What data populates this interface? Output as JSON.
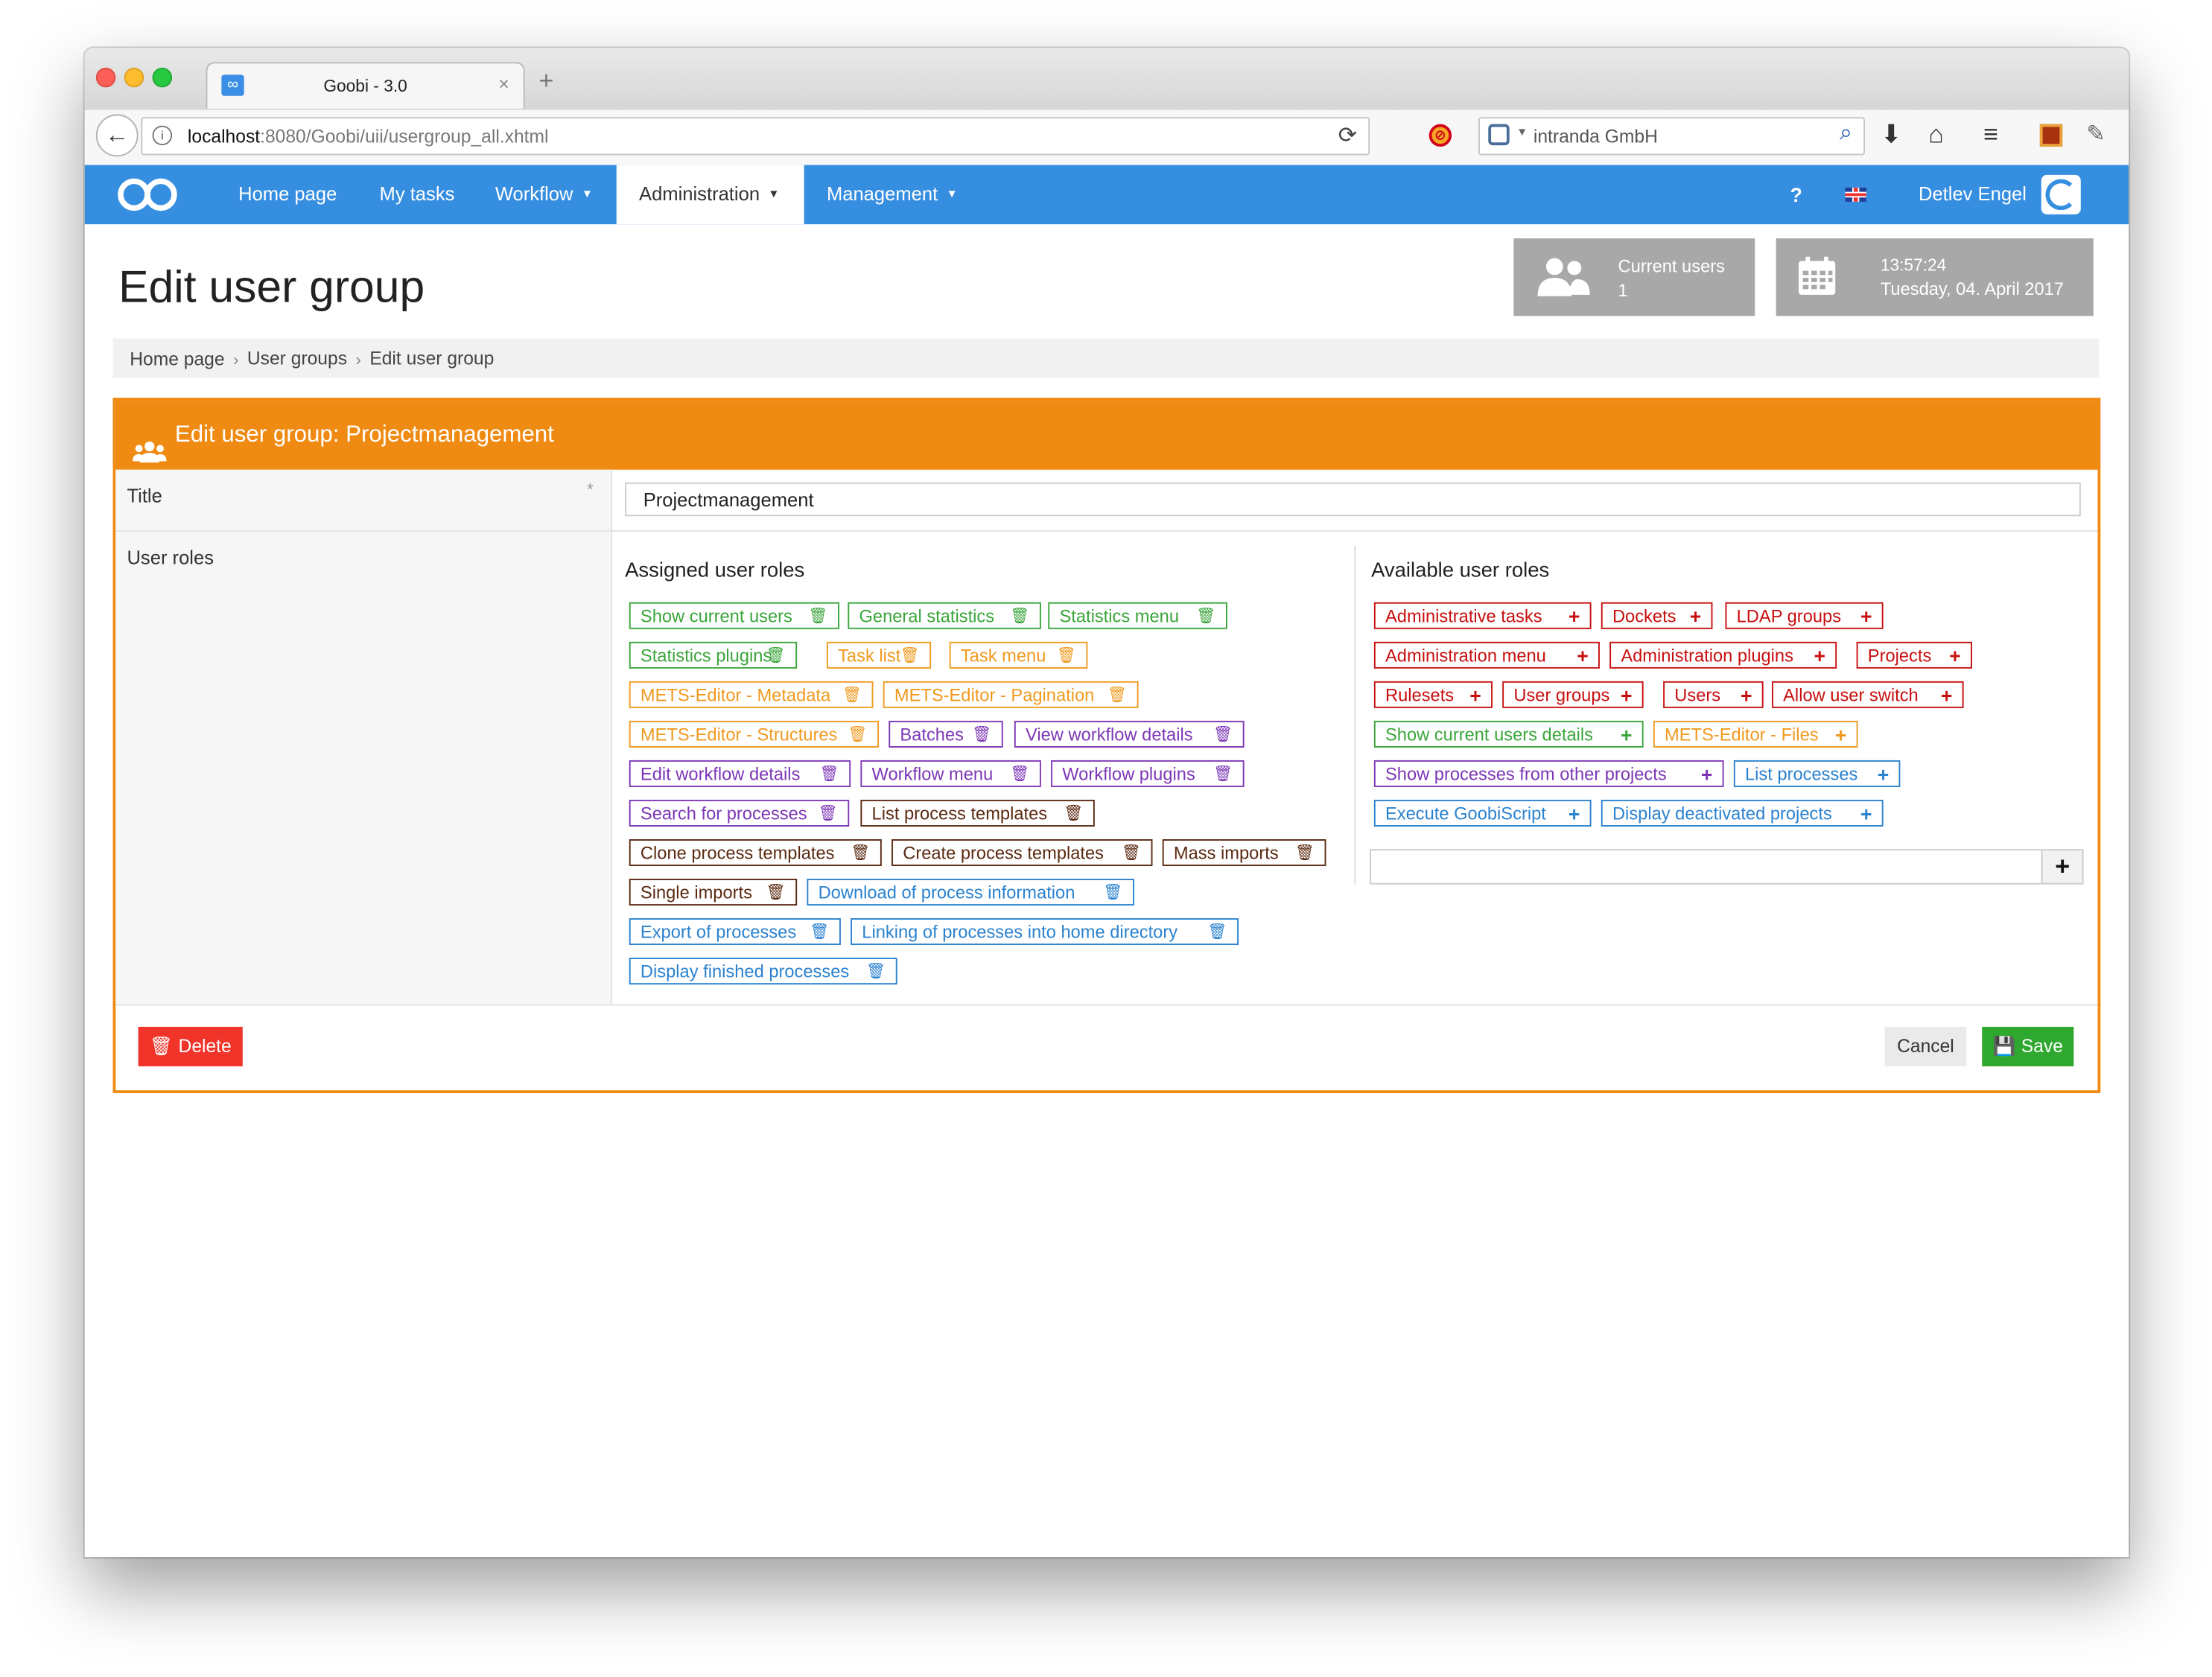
{
  "browser": {
    "tab_title": "Goobi - 3.0",
    "tab_close": "×",
    "new_tab": "+",
    "url_host": "localhost",
    "url_rest": ":8080/Goobi/uii/usergroup_all.xhtml",
    "search_text": "intranda GmbH"
  },
  "nav": {
    "items": [
      "Home page",
      "My tasks",
      "Workflow",
      "Administration",
      "Management"
    ],
    "active": "Administration",
    "help": "?",
    "user": "Detlev Engel",
    "accent_color": "#368ee0"
  },
  "page": {
    "title": "Edit user group",
    "current_users_label": "Current users",
    "current_users_count": "1",
    "time": "13:57:24",
    "date": "Tuesday, 04. April 2017"
  },
  "breadcrumb": [
    "Home page",
    "User groups",
    "Edit user group"
  ],
  "form": {
    "header": "Edit user group: Projectmanagement",
    "title_label": "Title",
    "required_mark": "*",
    "title_value": "Projectmanagement",
    "roles_label": "User roles",
    "assigned_heading": "Assigned user roles",
    "available_heading": "Available user roles",
    "assigned_roles": [
      {
        "label": "Show current users",
        "color": "green"
      },
      {
        "label": "General statistics",
        "color": "green"
      },
      {
        "label": "Statistics menu",
        "color": "green"
      },
      {
        "label": "Statistics plugins",
        "color": "green"
      },
      {
        "label": "Task list",
        "color": "orange"
      },
      {
        "label": "Task menu",
        "color": "orange"
      },
      {
        "label": "METS-Editor - Metadata",
        "color": "orange"
      },
      {
        "label": "METS-Editor - Pagination",
        "color": "orange"
      },
      {
        "label": "METS-Editor - Structures",
        "color": "orange"
      },
      {
        "label": "Batches",
        "color": "purple"
      },
      {
        "label": "View workflow details",
        "color": "purple"
      },
      {
        "label": "Edit workflow details",
        "color": "purple"
      },
      {
        "label": "Workflow menu",
        "color": "purple"
      },
      {
        "label": "Workflow plugins",
        "color": "purple"
      },
      {
        "label": "Search for processes",
        "color": "purple"
      },
      {
        "label": "List process templates",
        "color": "brown"
      },
      {
        "label": "Clone process templates",
        "color": "brown"
      },
      {
        "label": "Create process templates",
        "color": "brown"
      },
      {
        "label": "Mass imports",
        "color": "brown"
      },
      {
        "label": "Single imports",
        "color": "brown"
      },
      {
        "label": "Download of process information",
        "color": "blue"
      },
      {
        "label": "Export of processes",
        "color": "blue"
      },
      {
        "label": "Linking of processes into home directory",
        "color": "blue"
      },
      {
        "label": "Display finished processes",
        "color": "blue"
      }
    ],
    "available_roles": [
      {
        "label": "Administrative tasks",
        "color": "red"
      },
      {
        "label": "Dockets",
        "color": "red"
      },
      {
        "label": "LDAP groups",
        "color": "red"
      },
      {
        "label": "Administration menu",
        "color": "red"
      },
      {
        "label": "Administration plugins",
        "color": "red"
      },
      {
        "label": "Projects",
        "color": "red"
      },
      {
        "label": "Rulesets",
        "color": "red"
      },
      {
        "label": "User groups",
        "color": "red"
      },
      {
        "label": "Users",
        "color": "red"
      },
      {
        "label": "Allow user switch",
        "color": "red"
      },
      {
        "label": "Show current users details",
        "color": "green"
      },
      {
        "label": "METS-Editor - Files",
        "color": "orange"
      },
      {
        "label": "Show processes from other projects",
        "color": "purple"
      },
      {
        "label": "List processes",
        "color": "blue"
      },
      {
        "label": "Execute GoobiScript",
        "color": "blue"
      },
      {
        "label": "Display deactivated projects",
        "color": "blue"
      }
    ],
    "add_button": "+",
    "delete_label": "Delete",
    "cancel_label": "Cancel",
    "save_label": "Save",
    "header_color": "#ef8a12"
  }
}
